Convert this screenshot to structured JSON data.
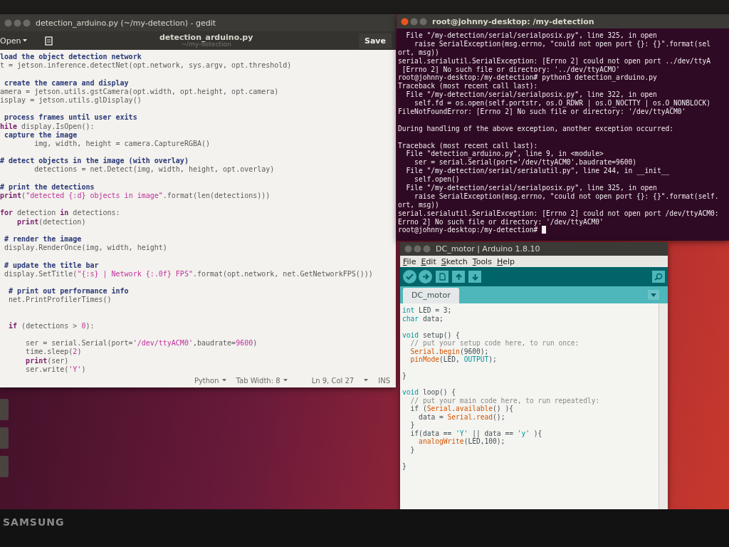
{
  "gedit": {
    "window_title": "detection_arduino.py (~/my-detection) - gedit",
    "header": {
      "open_button": "Open",
      "title": "detection_arduino.py",
      "subtitle": "~/my-detection",
      "save_button": "Save"
    },
    "code_lines": [
      {
        "kind": "code",
        "tokens": [
          {
            "kind": "comment",
            "text": "load the object detection network"
          }
        ]
      },
      {
        "kind": "code",
        "tokens": [
          {
            "kind": "plain",
            "text": "t = jetson.inference.detectNet(opt.network, sys.argv, opt.threshold)"
          }
        ]
      },
      {
        "kind": "blank"
      },
      {
        "kind": "code",
        "tokens": [
          {
            "kind": "comment",
            "text": " create the camera and display"
          }
        ]
      },
      {
        "kind": "code",
        "tokens": [
          {
            "kind": "plain",
            "text": "amera = jetson.utils.gstCamera(opt.width, opt.height, opt.camera)"
          }
        ]
      },
      {
        "kind": "code",
        "tokens": [
          {
            "kind": "plain",
            "text": "isplay = jetson.utils.glDisplay()"
          }
        ]
      },
      {
        "kind": "blank"
      },
      {
        "kind": "code",
        "tokens": [
          {
            "kind": "comment",
            "text": " process frames until user exits"
          }
        ]
      },
      {
        "kind": "code",
        "tokens": [
          {
            "kind": "keyword",
            "text": "hile"
          },
          {
            "kind": "plain",
            "text": " display.IsOpen():"
          }
        ]
      },
      {
        "kind": "code",
        "tokens": [
          {
            "kind": "comment",
            "text": " capture the image"
          }
        ]
      },
      {
        "kind": "code",
        "tokens": [
          {
            "kind": "plain",
            "text": "        img, width, height = camera.CaptureRGBA()"
          }
        ]
      },
      {
        "kind": "blank"
      },
      {
        "kind": "code",
        "tokens": [
          {
            "kind": "comment",
            "text": "# detect objects in the image (with overlay)"
          }
        ]
      },
      {
        "kind": "code",
        "tokens": [
          {
            "kind": "plain",
            "text": "        detections = net.Detect(img, width, height, opt.overlay)"
          }
        ]
      },
      {
        "kind": "blank"
      },
      {
        "kind": "code",
        "tokens": [
          {
            "kind": "comment",
            "text": "# print the detections"
          }
        ]
      },
      {
        "kind": "code",
        "tokens": [
          {
            "kind": "keyword",
            "text": "print"
          },
          {
            "kind": "plain",
            "text": "("
          },
          {
            "kind": "string",
            "text": "\"detected {:d} objects in image\""
          },
          {
            "kind": "plain",
            "text": ".format(len(detections)))"
          }
        ]
      },
      {
        "kind": "blank"
      },
      {
        "kind": "code",
        "tokens": [
          {
            "kind": "keyword",
            "text": "for"
          },
          {
            "kind": "plain",
            "text": " detection "
          },
          {
            "kind": "keyword",
            "text": "in"
          },
          {
            "kind": "plain",
            "text": " detections:"
          }
        ]
      },
      {
        "kind": "code",
        "tokens": [
          {
            "kind": "keyword",
            "text": "    print"
          },
          {
            "kind": "plain",
            "text": "(detection)"
          }
        ]
      },
      {
        "kind": "blank"
      },
      {
        "kind": "code",
        "tokens": [
          {
            "kind": "comment",
            "text": " # render the image"
          }
        ]
      },
      {
        "kind": "code",
        "tokens": [
          {
            "kind": "plain",
            "text": " display.RenderOnce(img, width, height)"
          }
        ]
      },
      {
        "kind": "blank"
      },
      {
        "kind": "code",
        "tokens": [
          {
            "kind": "comment",
            "text": " # update the title bar"
          }
        ]
      },
      {
        "kind": "code",
        "tokens": [
          {
            "kind": "plain",
            "text": " display.SetTitle("
          },
          {
            "kind": "string",
            "text": "\"{:s} | Network {:.0f} FPS\""
          },
          {
            "kind": "plain",
            "text": ".format(opt.network, net.GetNetworkFPS()))"
          }
        ]
      },
      {
        "kind": "blank"
      },
      {
        "kind": "code",
        "tokens": [
          {
            "kind": "comment",
            "text": "  # print out performance info"
          }
        ]
      },
      {
        "kind": "code",
        "tokens": [
          {
            "kind": "plain",
            "text": "  net.PrintProfilerTimes()"
          }
        ]
      },
      {
        "kind": "blank"
      },
      {
        "kind": "blank"
      },
      {
        "kind": "code",
        "tokens": [
          {
            "kind": "keyword",
            "text": "  if"
          },
          {
            "kind": "plain",
            "text": " (detections > "
          },
          {
            "kind": "string",
            "text": "0"
          },
          {
            "kind": "plain",
            "text": "):"
          }
        ]
      },
      {
        "kind": "blank"
      },
      {
        "kind": "code",
        "tokens": [
          {
            "kind": "plain",
            "text": "      ser = serial.Serial(port="
          },
          {
            "kind": "string",
            "text": "'/dev/ttyACM0'"
          },
          {
            "kind": "plain",
            "text": ",baudrate="
          },
          {
            "kind": "string",
            "text": "9600"
          },
          {
            "kind": "plain",
            "text": ")"
          }
        ]
      },
      {
        "kind": "code",
        "tokens": [
          {
            "kind": "plain",
            "text": "      time.sleep("
          },
          {
            "kind": "string",
            "text": "2"
          },
          {
            "kind": "plain",
            "text": ")"
          }
        ]
      },
      {
        "kind": "code",
        "tokens": [
          {
            "kind": "keyword",
            "text": "      print"
          },
          {
            "kind": "plain",
            "text": "(ser)"
          }
        ]
      },
      {
        "kind": "code",
        "tokens": [
          {
            "kind": "plain",
            "text": "      ser.write("
          },
          {
            "kind": "string",
            "text": "'Y'"
          },
          {
            "kind": "plain",
            "text": ")"
          }
        ]
      }
    ],
    "status_bar": {
      "language": "Python",
      "tab_width": "Tab Width: 8",
      "position": "Ln 9, Col 27",
      "mode": "INS"
    }
  },
  "terminal": {
    "window_title": "root@johnny-desktop: /my-detection",
    "lines": [
      {
        "kind": "text",
        "text": "  File \"/my-detection/serial/serialposix.py\", line 325, in open"
      },
      {
        "kind": "text",
        "text": "    raise SerialException(msg.errno, \"could not open port {}: {}\".format(sel"
      },
      {
        "kind": "text",
        "text": "ort, msg))"
      },
      {
        "kind": "text",
        "text": "serial.serialutil.SerialException: [Errno 2] could not open port ../dev/ttyA"
      },
      {
        "kind": "text",
        "text": " [Errno 2] No such file or directory: '../dev/ttyACMO'"
      },
      {
        "kind": "text",
        "text": "root@johnny-desktop:/my-detection# python3 detection_arduino.py"
      },
      {
        "kind": "text",
        "text": "Traceback (most recent call last):"
      },
      {
        "kind": "text",
        "text": "  File \"/my-detection/serial/serialposix.py\", line 322, in open"
      },
      {
        "kind": "text",
        "text": "    self.fd = os.open(self.portstr, os.O_RDWR | os.O_NOCTTY | os.O_NONBLOCK)"
      },
      {
        "kind": "text",
        "text": "FileNotFoundError: [Errno 2] No such file or directory: '/dev/ttyACM0'"
      },
      {
        "kind": "blank"
      },
      {
        "kind": "text",
        "text": "During handling of the above exception, another exception occurred:"
      },
      {
        "kind": "blank"
      },
      {
        "kind": "text",
        "text": "Traceback (most recent call last):"
      },
      {
        "kind": "text",
        "text": "  File \"detection_arduino.py\", line 9, in <module>"
      },
      {
        "kind": "text",
        "text": "    ser = serial.Serial(port='/dev/ttyACM0',baudrate=9600)"
      },
      {
        "kind": "text",
        "text": "  File \"/my-detection/serial/serialutil.py\", line 244, in __init__"
      },
      {
        "kind": "text",
        "text": "    self.open()"
      },
      {
        "kind": "text",
        "text": "  File \"/my-detection/serial/serialposix.py\", line 325, in open"
      },
      {
        "kind": "text",
        "text": "    raise SerialException(msg.errno, \"could not open port {}: {}\".format(self."
      },
      {
        "kind": "text",
        "text": "ort, msg))"
      },
      {
        "kind": "text",
        "text": "serial.serialutil.SerialException: [Errno 2] could not open port /dev/ttyACM0:"
      },
      {
        "kind": "text",
        "text": "Errno 2] No such file or directory: '/dev/ttyACM0'"
      },
      {
        "kind": "prompt",
        "text": "root@johnny-desktop:/my-detection# "
      }
    ]
  },
  "arduino": {
    "window_title": "DC_motor | Arduino 1.8.10",
    "menu": [
      "File",
      "Edit",
      "Sketch",
      "Tools",
      "Help"
    ],
    "tab": "DC_motor",
    "code_lines": [
      {
        "kind": "code",
        "tokens": [
          {
            "kind": "type",
            "text": "int"
          },
          {
            "kind": "plain",
            "text": " LED = 3;"
          }
        ]
      },
      {
        "kind": "code",
        "tokens": [
          {
            "kind": "type",
            "text": "char"
          },
          {
            "kind": "plain",
            "text": " data;"
          }
        ]
      },
      {
        "kind": "blank"
      },
      {
        "kind": "code",
        "tokens": [
          {
            "kind": "type",
            "text": "void"
          },
          {
            "kind": "plain",
            "text": " setup() {"
          }
        ]
      },
      {
        "kind": "code",
        "tokens": [
          {
            "kind": "comment",
            "text": "  // put your setup code here, to run once:"
          }
        ]
      },
      {
        "kind": "code",
        "tokens": [
          {
            "kind": "function",
            "text": "  Serial"
          },
          {
            "kind": "plain",
            "text": "."
          },
          {
            "kind": "function",
            "text": "begin"
          },
          {
            "kind": "plain",
            "text": "(9600);"
          }
        ]
      },
      {
        "kind": "code",
        "tokens": [
          {
            "kind": "function",
            "text": "  pinMode"
          },
          {
            "kind": "plain",
            "text": "(LED, "
          },
          {
            "kind": "type",
            "text": "OUTPUT"
          },
          {
            "kind": "plain",
            "text": ");"
          }
        ]
      },
      {
        "kind": "blank"
      },
      {
        "kind": "code",
        "tokens": [
          {
            "kind": "plain",
            "text": "}"
          }
        ]
      },
      {
        "kind": "blank"
      },
      {
        "kind": "code",
        "tokens": [
          {
            "kind": "type",
            "text": "void"
          },
          {
            "kind": "plain",
            "text": " loop() {"
          }
        ]
      },
      {
        "kind": "code",
        "tokens": [
          {
            "kind": "comment",
            "text": "  // put your main code here, to run repeatedly:"
          }
        ]
      },
      {
        "kind": "code",
        "tokens": [
          {
            "kind": "plain",
            "text": "  if ("
          },
          {
            "kind": "function",
            "text": "Serial"
          },
          {
            "kind": "plain",
            "text": "."
          },
          {
            "kind": "function",
            "text": "available"
          },
          {
            "kind": "plain",
            "text": "() ){"
          }
        ]
      },
      {
        "kind": "code",
        "tokens": [
          {
            "kind": "plain",
            "text": "    data = "
          },
          {
            "kind": "function",
            "text": "Serial"
          },
          {
            "kind": "plain",
            "text": "."
          },
          {
            "kind": "function",
            "text": "read"
          },
          {
            "kind": "plain",
            "text": "();"
          }
        ]
      },
      {
        "kind": "code",
        "tokens": [
          {
            "kind": "plain",
            "text": "  }"
          }
        ]
      },
      {
        "kind": "code",
        "tokens": [
          {
            "kind": "plain",
            "text": "  if(data == "
          },
          {
            "kind": "type",
            "text": "'Y'"
          },
          {
            "kind": "plain",
            "text": " || data == "
          },
          {
            "kind": "type",
            "text": "'y'"
          },
          {
            "kind": "plain",
            "text": " ){"
          }
        ]
      },
      {
        "kind": "code",
        "tokens": [
          {
            "kind": "function",
            "text": "    analogWrite"
          },
          {
            "kind": "plain",
            "text": "(LED,100);"
          }
        ]
      },
      {
        "kind": "code",
        "tokens": [
          {
            "kind": "plain",
            "text": "  }"
          }
        ]
      },
      {
        "kind": "blank"
      },
      {
        "kind": "code",
        "tokens": [
          {
            "kind": "plain",
            "text": "}"
          }
        ]
      }
    ]
  },
  "monitor": {
    "brand": "SAMSUNG"
  }
}
